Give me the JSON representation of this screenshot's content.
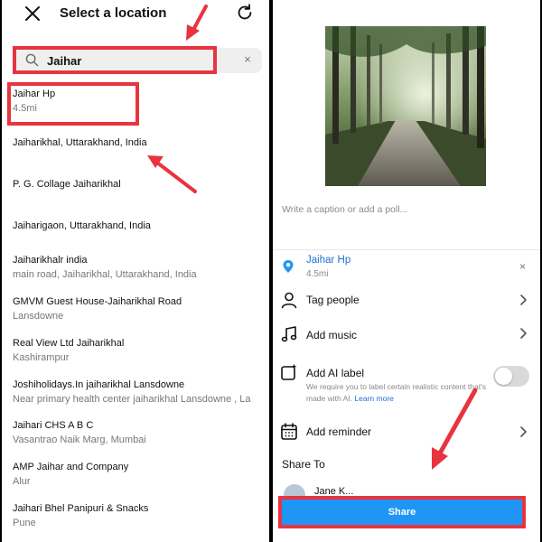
{
  "left_panel": {
    "header": {
      "title": "Select a location",
      "close_icon": "close-icon",
      "refresh_icon": "refresh-icon"
    },
    "search": {
      "value": "Jaihar",
      "icon": "search-icon",
      "clear_label": "×"
    },
    "results": [
      {
        "title": "Jaihar Hp",
        "subtitle": "4.5mi"
      },
      {
        "title": "Jaiharikhal, Uttarakhand, India",
        "subtitle": ""
      },
      {
        "title": "P. G. Collage Jaiharikhal",
        "subtitle": ""
      },
      {
        "title": "Jaiharigaon, Uttarakhand, India",
        "subtitle": ""
      },
      {
        "title": "Jaiharikhalr india",
        "subtitle": "main road, Jaiharikhal, Uttarakhand, India"
      },
      {
        "title": "GMVM Guest House-Jaiharikhal Road",
        "subtitle": "Lansdowne"
      },
      {
        "title": "Real View Ltd Jaiharikhal",
        "subtitle": "Kashirampur"
      },
      {
        "title": "Joshiholidays.In  jaiharikhal Lansdowne",
        "subtitle": "Near primary health center  jaiharikhal Lansdowne , La"
      },
      {
        "title": "Jaihari CHS A B C",
        "subtitle": "Vasantrao Naik Marg, Mumbai"
      },
      {
        "title": "AMP Jaihar and Company",
        "subtitle": "Alur"
      },
      {
        "title": "Jaihari Bhel Panipuri & Snacks",
        "subtitle": "Pune"
      }
    ]
  },
  "right_panel": {
    "caption_placeholder": "Write a caption or add a poll...",
    "location": {
      "title": "Jaihar Hp",
      "subtitle": "4.5mi",
      "remove_label": "×",
      "icon": "location-pin-icon"
    },
    "options": {
      "tag_people": "Tag people",
      "add_music": "Add music",
      "add_ai_label": "Add AI label",
      "ai_description": "We require you to label certain realistic content that's made with AI.",
      "ai_learn_more": "Learn more",
      "ai_toggle_on": false,
      "add_reminder": "Add reminder"
    },
    "share_to_label": "Share To",
    "peek_name": "Jane K...",
    "share_button": "Share"
  },
  "colors": {
    "accent_blue": "#1f96f5",
    "link_blue": "#1f6fd1",
    "highlight_red": "#e8343f"
  }
}
